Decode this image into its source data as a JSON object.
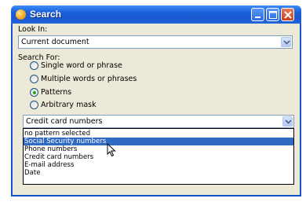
{
  "window": {
    "title": "Search"
  },
  "look_in": {
    "label": "Look In:",
    "value": "Current document"
  },
  "search_for": {
    "label": "Search For:",
    "options": [
      {
        "label": "Single word or phrase",
        "selected": false
      },
      {
        "label": "Multiple words or phrases",
        "selected": false
      },
      {
        "label": "Patterns",
        "selected": true
      },
      {
        "label": "Arbitrary mask",
        "selected": false
      }
    ]
  },
  "pattern": {
    "value": "Credit card numbers",
    "options": [
      "no pattern selected",
      "Social Security numbers",
      "Phone numbers",
      "Credit card numbers",
      "E-mail address",
      "Date"
    ],
    "highlighted": "Social Security numbers"
  },
  "colors": {
    "titlebar": "#1b58cf",
    "selection": "#316ac5",
    "dialog_bg": "#ece9d8"
  },
  "icons": [
    "app-icon",
    "minimize-icon",
    "maximize-icon",
    "close-icon",
    "chevron-down-icon",
    "mouse-cursor-icon"
  ]
}
